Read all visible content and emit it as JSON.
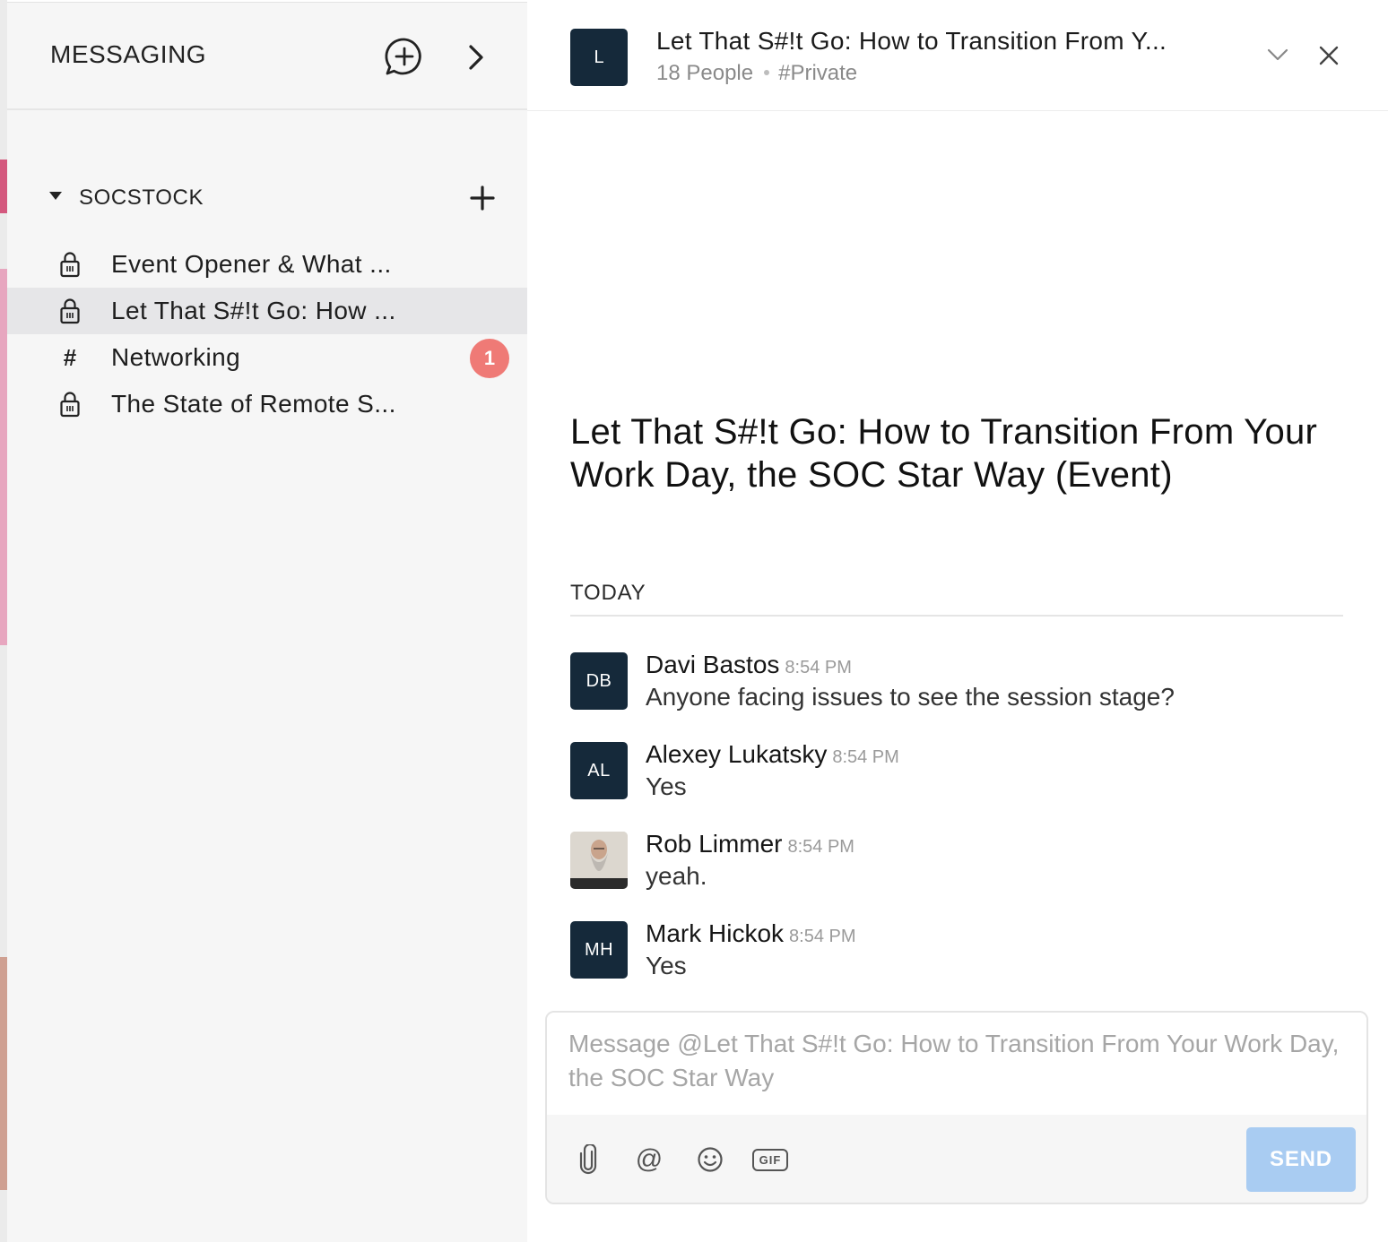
{
  "colors": {
    "sidebar_bg": "#f6f6f6",
    "active_channel_bg": "#e6e6e8",
    "avatar_bg": "#15293a",
    "badge_bg": "#ef7a76",
    "send_button_bg": "#a9ccf2"
  },
  "sidebar": {
    "title": "MESSAGING",
    "new_message_icon": "chat-plus-icon",
    "expand_icon": "chevron-right-icon",
    "group": {
      "label": "SOCSTOCK",
      "caret_icon": "caret-down-icon",
      "add_icon": "plus-icon"
    },
    "channels": [
      {
        "label": "Event Opener & What ...",
        "icon": "lock-icon",
        "active": false
      },
      {
        "label": "Let That S#!t Go: How ...",
        "icon": "lock-icon",
        "active": true
      },
      {
        "label": "Networking",
        "icon": "hash-icon",
        "icon_glyph": "#",
        "badge": "1",
        "active": false
      },
      {
        "label": "The State of Remote S...",
        "icon": "lock-icon",
        "active": false
      }
    ]
  },
  "chat": {
    "avatar_initial": "L",
    "title": "Let That S#!t Go: How to Transition From Y...",
    "people": "18 People",
    "privacy": "#Private",
    "collapse_icon": "chevron-down-icon",
    "close_icon": "close-icon",
    "big_title": "Let That S#!t Go: How to Transition From Your Work Day, the SOC Star Way (Event)",
    "day_label": "TODAY",
    "messages": [
      {
        "initials": "DB",
        "name": "Davi Bastos",
        "time": "8:54 PM",
        "text": "Anyone facing issues to see the session stage?"
      },
      {
        "initials": "AL",
        "name": "Alexey Lukatsky",
        "time": "8:54 PM",
        "text": "Yes"
      },
      {
        "initials": "",
        "name": "Rob Limmer",
        "time": "8:54 PM",
        "text": "yeah."
      },
      {
        "initials": "MH",
        "name": "Mark Hickok",
        "time": "8:54 PM",
        "text": "Yes"
      }
    ]
  },
  "composer": {
    "placeholder": "Message @Let That S#!t Go: How to Transition From Your Work Day, the SOC Star Way",
    "value": "",
    "tools": [
      "paperclip-icon",
      "at-icon",
      "emoji-icon",
      "gif-icon"
    ],
    "gif_label": "GIF",
    "at_glyph": "@",
    "send_label": "SEND"
  }
}
